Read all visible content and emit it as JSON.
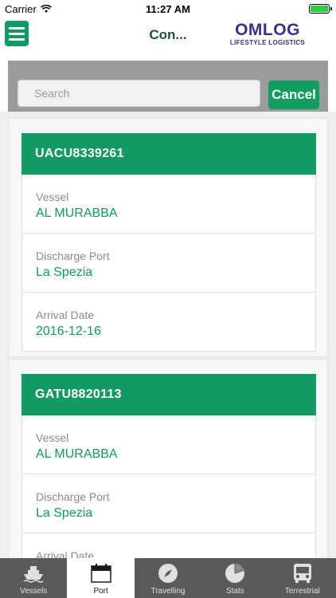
{
  "status_bar": {
    "carrier": "Carrier",
    "time": "11:27 AM"
  },
  "nav": {
    "title": "Con...",
    "logo_main": "OMLOG",
    "logo_sub": "LIFESTYLE LOGISTICS"
  },
  "search": {
    "placeholder": "Search",
    "value": "",
    "cancel_label": "Cancel"
  },
  "containers": [
    {
      "id": "UACU8339261",
      "fields": [
        {
          "label": "Vessel",
          "value": "AL MURABBA"
        },
        {
          "label": "Discharge Port",
          "value": "La Spezia"
        },
        {
          "label": "Arrival Date",
          "value": "2016-12-16"
        }
      ]
    },
    {
      "id": "GATU8820113",
      "fields": [
        {
          "label": "Vessel",
          "value": "AL MURABBA"
        },
        {
          "label": "Discharge Port",
          "value": "La Spezia"
        },
        {
          "label": "Arrival Date",
          "value": ""
        }
      ]
    }
  ],
  "tabs": [
    {
      "label": "Vessels",
      "icon": "ship-icon",
      "active": false
    },
    {
      "label": "Port",
      "icon": "calendar-icon",
      "active": true
    },
    {
      "label": "Travelling",
      "icon": "compass-icon",
      "active": false
    },
    {
      "label": "Stats",
      "icon": "pie-chart-icon",
      "active": false
    },
    {
      "label": "Terrestrial",
      "icon": "bus-icon",
      "active": false
    }
  ],
  "colors": {
    "accent": "#129a62",
    "tab_bar": "#5a5a5a",
    "logo": "#3f2e8c",
    "logo_ring": "#e84a8d"
  }
}
